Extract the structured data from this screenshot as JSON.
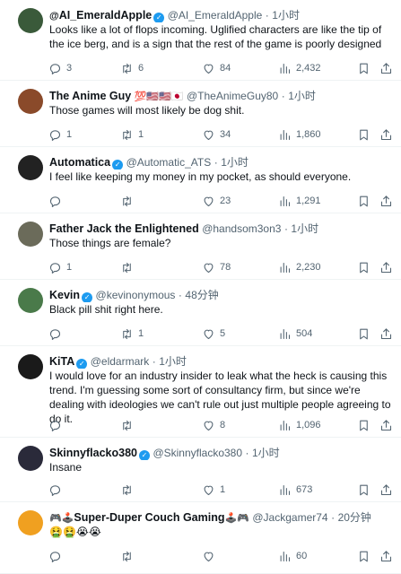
{
  "tweets": [
    {
      "name": "AI_EmeraldApple",
      "name_prefix_emoji": "@",
      "verified": true,
      "handle": "@AI_EmeraldApple",
      "time": "1小时",
      "text": "Looks like a lot of flops incoming. Uglified characters are like the tip of the ice berg, and is a sign that the rest of the game is poorly designed",
      "replies": "3",
      "reposts": "6",
      "likes": "84",
      "views": "2,432",
      "avatar_color": "#3a5a3a"
    },
    {
      "name": "The Anime Guy",
      "name_emojis": "💯🇺🇸🇺🇸🇯🇵",
      "verified": false,
      "handle": "@TheAnimeGuy80",
      "time": "1小时",
      "text": "Those games will most likely be dog shit.",
      "replies": "1",
      "reposts": "1",
      "likes": "34",
      "views": "1,860",
      "avatar_color": "#8a4a2a"
    },
    {
      "name": "Automatica",
      "verified": true,
      "handle": "@Automatic_ATS",
      "time": "1小时",
      "text": "I feel like keeping my money in my pocket, as should everyone.",
      "replies": "",
      "reposts": "",
      "likes": "23",
      "views": "1,291",
      "avatar_color": "#222222"
    },
    {
      "name": "Father Jack the Enlightened",
      "verified": false,
      "handle": "@handsom3on3",
      "time": "1小时",
      "text": "Those things are female?",
      "replies": "1",
      "reposts": "",
      "likes": "78",
      "views": "2,230",
      "avatar_color": "#6b6b5a"
    },
    {
      "name": "Kevin",
      "verified": true,
      "handle": "@kevinonymous",
      "time": "48分钟",
      "text": "Black pill shit right here.",
      "replies": "",
      "reposts": "1",
      "likes": "5",
      "views": "504",
      "avatar_color": "#4a7a4a"
    },
    {
      "name": "KiTA",
      "verified": true,
      "handle": "@eldarmark",
      "time": "1小时",
      "text": "I would love for an industry insider to leak what the heck is causing this trend.  I'm guessing some sort of consultancy firm, but since we're dealing with ideologies we can't rule out just multiple people agreeing to do it.",
      "replies": "",
      "reposts": "",
      "likes": "8",
      "views": "1,096",
      "avatar_color": "#1a1a1a"
    },
    {
      "name": "Skinnyflacko380",
      "verified": true,
      "handle": "@Skinnyflacko380",
      "time": "1小时",
      "text": "Insane",
      "replies": "",
      "reposts": "",
      "likes": "1",
      "views": "673",
      "avatar_color": "#2a2a3a"
    },
    {
      "name": "Super-Duper Couch Gaming",
      "name_prefix_emoji": "🎮🕹️",
      "name_suffix_emoji": "🕹️🎮",
      "verified": false,
      "handle": "@Jackgamer74",
      "time": "20分钟",
      "text": "🤮🤮😭😭",
      "replies": "",
      "reposts": "",
      "likes": "",
      "views": "60",
      "avatar_color": "#f0a020"
    }
  ],
  "separator": "·",
  "icons": {
    "reply": "reply-icon",
    "repost": "repost-icon",
    "like": "heart-icon",
    "views": "views-icon",
    "bookmark": "bookmark-icon",
    "share": "share-icon"
  },
  "colors": {
    "verified_badge": "#1d9bf0",
    "secondary_text": "#536471",
    "primary_text": "#0f1419",
    "divider": "#eff3f4"
  }
}
